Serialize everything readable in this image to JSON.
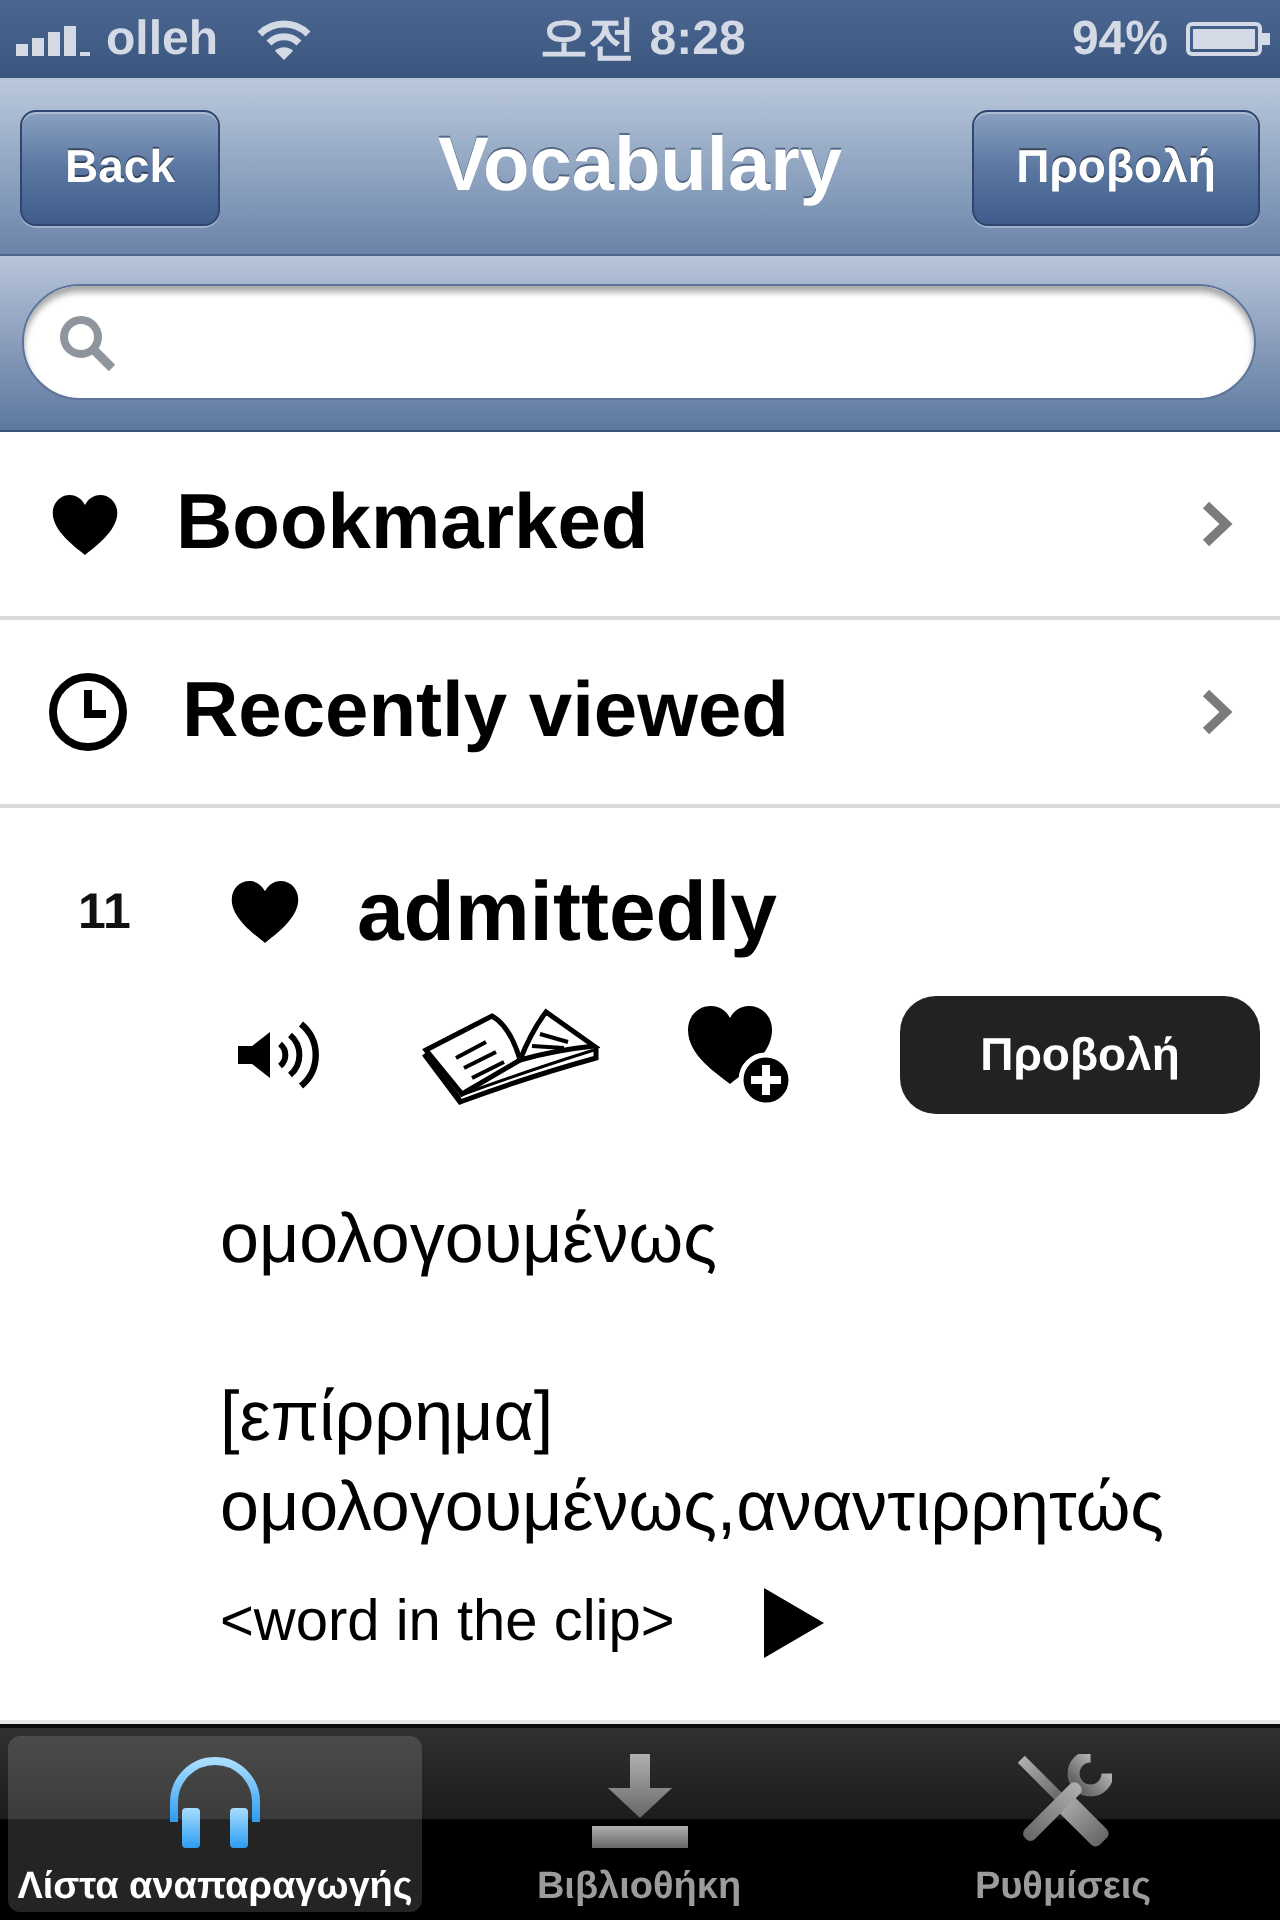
{
  "status_bar": {
    "carrier": "olleh",
    "time": "오전 8:28",
    "battery": "94%"
  },
  "nav_bar": {
    "back_button": "Back",
    "title": "Vocabulary",
    "view_button": "Προβολή"
  },
  "menu": [
    {
      "kind": "bookmarks",
      "label": "Bookmarked"
    },
    {
      "kind": "history",
      "label": "Recently viewed"
    }
  ],
  "entry": {
    "number": "11",
    "bookmarked": true,
    "word": "admittedly",
    "view_button": "Προβολή",
    "translation": "ομολογουμένως",
    "part_of_speech": "[επίρρημα]",
    "definition": "ομολογουμένως,αναντιρρητώς",
    "clip_label": "<word in the clip>"
  },
  "tabs": [
    {
      "kind": "playlist",
      "label": "Λίστα αναπαραγωγής",
      "selected": true
    },
    {
      "kind": "library",
      "label": "Βιβλιοθήκη",
      "selected": false
    },
    {
      "kind": "settings",
      "label": "Ρυθμίσεις",
      "selected": false
    }
  ]
}
